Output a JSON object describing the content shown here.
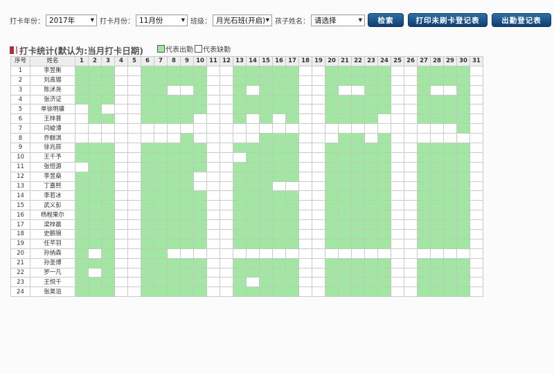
{
  "filters": {
    "year_label": "打卡年份：",
    "year_value": "2017年",
    "month_label": "打卡月份：",
    "month_value": "11月份",
    "class_label": "班级：",
    "class_value": "月光石班(开启)",
    "child_label": "孩子姓名：",
    "child_value": "请选择"
  },
  "buttons": {
    "search": "检索",
    "print_unswiped": "打印未刷卡登记表",
    "attendance_register": "出勤登记表"
  },
  "section": {
    "title": "打卡统计(默认为:当月打卡日期)"
  },
  "legend": {
    "present_label": "代表出勤",
    "absent_label": "代表缺勤",
    "present_color": "#a3e6a3",
    "absent_color": "#ffffff"
  },
  "table": {
    "header_index": "序号",
    "header_name": "姓名",
    "days": [
      "1",
      "2",
      "3",
      "4",
      "5",
      "6",
      "7",
      "8",
      "9",
      "10",
      "11",
      "12",
      "13",
      "14",
      "15",
      "16",
      "17",
      "18",
      "19",
      "20",
      "21",
      "22",
      "23",
      "24",
      "25",
      "26",
      "27",
      "28",
      "29",
      "30",
      "31"
    ],
    "rows": [
      {
        "index": "1",
        "name": "李昱衡",
        "att": "1110011111001111100111110011110"
      },
      {
        "index": "2",
        "name": "刘禹锡",
        "att": "1110011111001111100111110011110"
      },
      {
        "index": "3",
        "name": "陈沭尧",
        "att": "1110011001001011100100110010010"
      },
      {
        "index": "4",
        "name": "张济证",
        "att": "1110011111001111100111110011110"
      },
      {
        "index": "5",
        "name": "单徐明骥",
        "att": "0100011111001111100111110011110"
      },
      {
        "index": "6",
        "name": "王梓晋",
        "att": "0110011110001010100111100011110"
      },
      {
        "index": "7",
        "name": "闫峻溥",
        "att": "0000000000000000000000000000010"
      },
      {
        "index": "8",
        "name": "乔麒淇",
        "att": "0000000010000011100011010000000"
      },
      {
        "index": "9",
        "name": "徐兆辰",
        "att": "1110011111001111100111110011110"
      },
      {
        "index": "10",
        "name": "王千予",
        "att": "1110011111000111100111110011110"
      },
      {
        "index": "11",
        "name": "张恒源",
        "att": "0110011111001111100111110011110"
      },
      {
        "index": "12",
        "name": "李昱燊",
        "att": "1110011110001111100111110011110"
      },
      {
        "index": "13",
        "name": "丁嘉熙",
        "att": "1110011110001110000111110011110"
      },
      {
        "index": "14",
        "name": "李若冰",
        "att": "1110011111001111100111110011110"
      },
      {
        "index": "15",
        "name": "武义彭",
        "att": "1110011111001111100111110011110"
      },
      {
        "index": "16",
        "name": "杨程果尔",
        "att": "1110011111001111100111110011110"
      },
      {
        "index": "17",
        "name": "梁梓晨",
        "att": "1110011111001111100111110011110"
      },
      {
        "index": "18",
        "name": "史鹏锦",
        "att": "1110011111001111100111110011110"
      },
      {
        "index": "19",
        "name": "任芊羽",
        "att": "1110011111001111100111110011110"
      },
      {
        "index": "20",
        "name": "孙纳森",
        "att": "1010011000000000000000000000000"
      },
      {
        "index": "21",
        "name": "孙圣博",
        "att": "1110011111001111100111110011110"
      },
      {
        "index": "22",
        "name": "罗一凡",
        "att": "1010011111001111100111110011110"
      },
      {
        "index": "23",
        "name": "王悦千",
        "att": "1110011111001011100111110011110"
      },
      {
        "index": "24",
        "name": "张昊溢",
        "att": "1110011111001111100111110011110"
      }
    ]
  }
}
